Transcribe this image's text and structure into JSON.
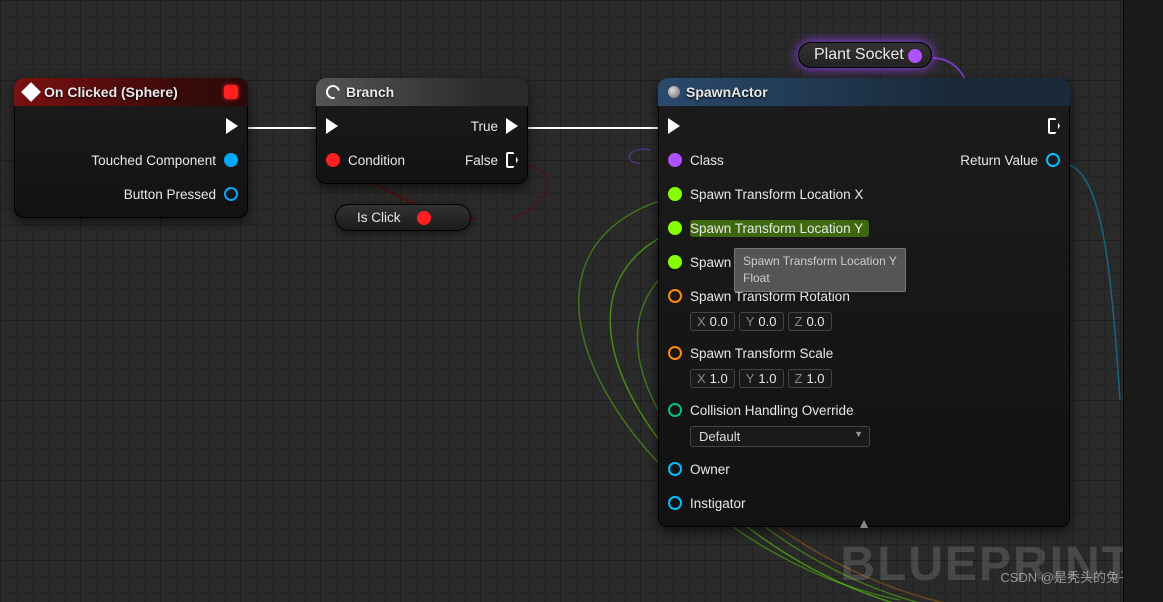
{
  "nodes": {
    "onclicked": {
      "title": "On Clicked (Sphere)",
      "outputs": {
        "touched": "Touched Component",
        "button": "Button Pressed"
      }
    },
    "branch": {
      "title": "Branch",
      "condition": "Condition",
      "true": "True",
      "false": "False"
    },
    "isclick": {
      "label": "Is Click"
    },
    "plantsocket": {
      "label": "Plant Socket"
    },
    "spawn": {
      "title": "SpawnActor",
      "class": "Class",
      "locX": "Spawn Transform Location X",
      "locY": "Spawn Transform Location Y",
      "locZ": "Spawn Transform Location Z",
      "rotation": "Spawn Transform Rotation",
      "scale": "Spawn Transform Scale",
      "collision": "Collision Handling Override",
      "collision_value": "Default",
      "owner": "Owner",
      "instigator": "Instigator",
      "return": "Return Value",
      "rot_x": "0.0",
      "rot_y": "0.0",
      "rot_z": "0.0",
      "scl_x": "1.0",
      "scl_y": "1.0",
      "scl_z": "1.0"
    }
  },
  "tooltip": {
    "line1": "Spawn Transform Location Y",
    "line2": "Float"
  },
  "watermark": "BLUEPRINT",
  "csdn": "CSDN @是秃头的兔子呀"
}
